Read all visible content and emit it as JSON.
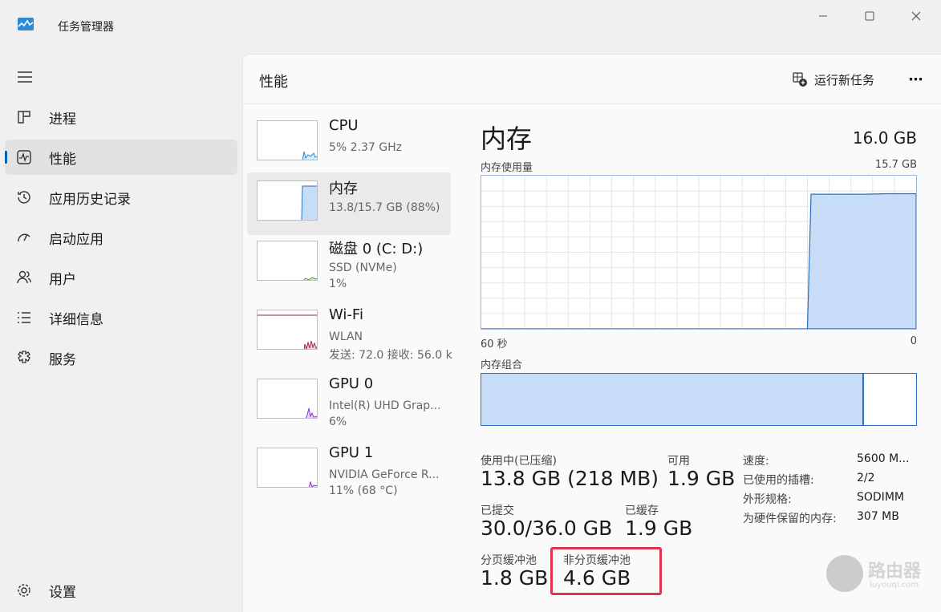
{
  "window": {
    "title": "任务管理器",
    "icons": {
      "app": "task-manager-icon",
      "minimize": "minimize-icon",
      "maximize": "maximize-icon",
      "close": "close-icon"
    }
  },
  "sidebar": {
    "menu_icon": "hamburger-icon",
    "items": [
      {
        "label": "进程",
        "icon": "processes-icon"
      },
      {
        "label": "性能",
        "icon": "performance-icon",
        "active": true
      },
      {
        "label": "应用历史记录",
        "icon": "history-icon"
      },
      {
        "label": "启动应用",
        "icon": "startup-icon"
      },
      {
        "label": "用户",
        "icon": "users-icon"
      },
      {
        "label": "详细信息",
        "icon": "details-icon"
      },
      {
        "label": "服务",
        "icon": "services-icon"
      }
    ],
    "settings_label": "设置"
  },
  "header": {
    "title": "性能",
    "run_task_label": "运行新任务",
    "more_label": "⋯"
  },
  "devices": [
    {
      "name": "CPU",
      "sub1": "5% 2.37 GHz",
      "sub2": "",
      "color": "#1a8ec9"
    },
    {
      "name": "内存",
      "sub1": "13.8/15.7 GB (88%)",
      "sub2": "",
      "color": "#2b6fc0"
    },
    {
      "name": "磁盘 0 (C: D:)",
      "sub1": "SSD (NVMe)",
      "sub2": "1%",
      "color": "#4a9a2a"
    },
    {
      "name": "Wi-Fi",
      "sub1": "WLAN",
      "sub2": "发送: 72.0 接收: 56.0 k",
      "color": "#a2195b"
    },
    {
      "name": "GPU 0",
      "sub1": "Intel(R) UHD Grap...",
      "sub2": "6%",
      "color": "#8a2be2"
    },
    {
      "name": "GPU 1",
      "sub1": "NVIDIA GeForce R...",
      "sub2": "11% (68 °C)",
      "color": "#8a2be2"
    }
  ],
  "memory": {
    "title": "内存",
    "total": "16.0 GB",
    "usage_label": "内存使用量",
    "usage_max": "15.7 GB",
    "axis_left": "60 秒",
    "axis_right": "0",
    "composition_label": "内存组合",
    "composition_used_fraction": 0.88,
    "stats": {
      "in_use_label": "使用中(已压缩)",
      "in_use_value": "13.8 GB (218 MB)",
      "available_label": "可用",
      "available_value": "1.9 GB",
      "committed_label": "已提交",
      "committed_value": "30.0/36.0 GB",
      "cached_label": "已缓存",
      "cached_value": "1.9 GB",
      "paged_label": "分页缓冲池",
      "paged_value": "1.8 GB",
      "nonpaged_label": "非分页缓冲池",
      "nonpaged_value": "4.6 GB"
    },
    "specs": [
      {
        "key": "速度:",
        "value": "5600 M..."
      },
      {
        "key": "已使用的插槽:",
        "value": "2/2"
      },
      {
        "key": "外形规格:",
        "value": "SODIMM"
      },
      {
        "key": "为硬件保留的内存:",
        "value": "307 MB"
      }
    ]
  },
  "chart_data": {
    "type": "area",
    "title": "内存使用量",
    "x": [
      60,
      57,
      54,
      51,
      48,
      45,
      42,
      39,
      36,
      33,
      30,
      27,
      24,
      21,
      18,
      15,
      14.5,
      13,
      10,
      7,
      4,
      0
    ],
    "values": [
      0,
      0,
      0,
      0,
      0,
      0,
      0,
      0,
      0,
      0,
      0,
      0,
      0,
      0,
      0,
      0,
      13.8,
      13.8,
      13.8,
      13.8,
      13.85,
      13.85
    ],
    "xlim": [
      60,
      0
    ],
    "ylim": [
      0,
      15.7
    ],
    "grid": true,
    "fill_color": "#c6dcf7",
    "line_color": "#2b6fc0"
  },
  "watermark": {
    "text": "路由器",
    "url": "luyouqi.com"
  }
}
